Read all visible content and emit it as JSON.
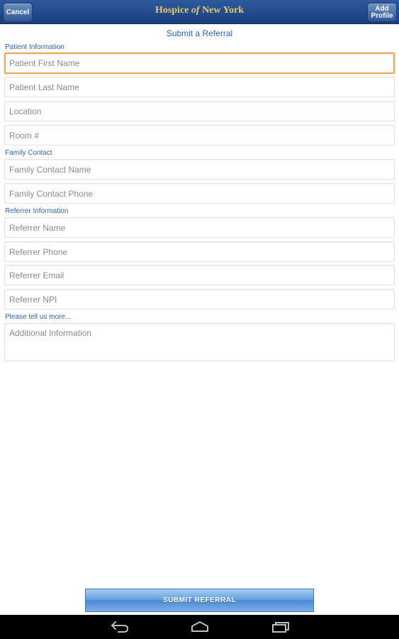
{
  "navbar": {
    "cancel_label": "Cancel",
    "brand_part1": "Hospice ",
    "brand_of": "of",
    "brand_part2": " New York",
    "add_profile_line1": "Add",
    "add_profile_line2": "Profile"
  },
  "page": {
    "title": "Submit a Referral"
  },
  "sections": {
    "patient_label": "Patient Information",
    "family_label": "Family Contact",
    "referrer_label": "Referrer Information",
    "more_label": "Please tell us more..."
  },
  "fields": {
    "patient_first_name": "Patient First Name",
    "patient_last_name": "Patient Last Name",
    "location": "Location",
    "room": "Room #",
    "family_contact_name": "Family Contact Name",
    "family_contact_phone": "Family Contact Phone",
    "referrer_name": "Referrer Name",
    "referrer_phone": "Referrer Phone",
    "referrer_email": "Referrer Email",
    "referrer_npi": "Referrer NPI",
    "additional_info": "Additional Information"
  },
  "submit_label": "SUBMIT REFERRAL",
  "icons": {
    "back": "back-icon",
    "home": "home-icon",
    "recent": "recent-apps-icon"
  },
  "colors": {
    "navbar": "#1a3f7c",
    "brand": "#e7c86a",
    "accent_text": "#2b63c4",
    "focus_border": "#f2a450",
    "submit": "#5d9bde"
  }
}
